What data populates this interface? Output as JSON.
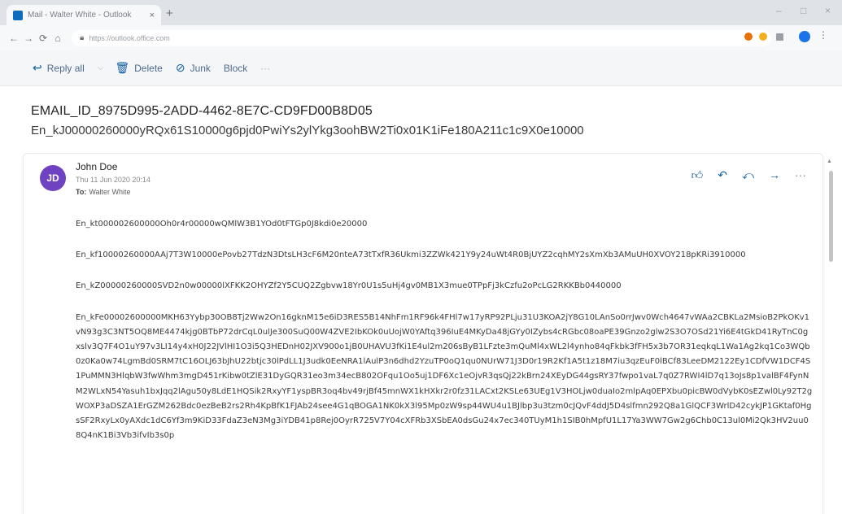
{
  "browser": {
    "tab_title": "Mail - Walter White - Outlook",
    "tab_close": "×",
    "new_tab": "+",
    "url": "https://outlook.office.com",
    "window_controls": [
      "–",
      "□",
      "×"
    ]
  },
  "toolbar": {
    "reply_all": "Reply all",
    "delete": "Delete",
    "junk": "Junk",
    "block": "Block",
    "more": "···"
  },
  "subject": {
    "line1": "EMAIL_ID_8975D995-2ADD-4462-8E7C-CD9FD00B8D05",
    "line2": "En_kJ00000260000yRQx61S10000g6pjd0PwiYs2ylYkg3oohBW2Ti0x01K1iFe180A211c1c9X0e10000"
  },
  "message": {
    "avatar_initials": "JD",
    "sender": "John Doe",
    "date": "Thu 11 Jun 2020 20:14",
    "to_label": "To:",
    "to": "Walter White",
    "more": "···",
    "body": [
      "En_kt000002600000Oh0r4r00000wQMlW3B1YOd0tFTGp0J8kdi0e20000",
      "En_kf10000260000AAj7T3W10000ePovb27TdzN3DtsLH3cF6M20nteA73tTxfR36Ukmi3ZZWk421Y9y24uWt4R0BjUYZ2cqhMY2sXmXb3AMuUH0XVOY218pKRi3910000",
      "En_kZ00000260000SVD2n0w00000lXFKK2OHYZf2Y5CUQ2Zgbvw18Yr0U1s5uHj4gv0MB1X3mue0TPpFj3kCzfu2oPcLG2RKKBb0440000",
      "En_kFe00002600000MKH63Yybp30OB8Tj2Ww2On16gknM15e6iD3RES5B14NhFm1RF96k4FHl7w17yRP92PLju31U3KOA2jY8G10LAnSo0rrJwv0Wch4647vWAa2CBKLa2MsioB2PkOKv1vN93g3C3NT5OQ8ME4474kjg0BTbP72drCqL0ulJe300SuQ00W4ZVE2IbKOk0uUojW0YAftq396IuE4MKyDa48jGYy0IZybs4cRGbc08oaPE39Gnzo2glw2S3O7OSd21Yi6E4tGkD41RyTnC0gxslv3Q7F4O1uY97v3LI14y4xH0J22JVlHI1O3i5Q3HEDnH02JXV900o1jB0UHAVU3fKi1E4ul2m206sByB1LFzte3mQuMl4xWL2l4ynho84qFkbk3fFH5x3b7OR31eqkqL1Wa1Ag2kq1Co3WQb0z0Ka0w74LgmBd0SRM7tC16OLJ63bJhU22btjc30lPdLL1J3udk0EeNRA1lAulP3n6dhd2YzuTP0oQ1qu0NUrW71J3D0r19R2Kf1A5t1z18M7iu3qzEuF0lBCf83LeeDM2122Ey1CDfVW1DCF4S1PuMMN3HlqbW3fwWhm3mgD451rKibw0tZlE31DyGQR31eo3m34ecB802OFqu1Oo5uj1DF6Xc1eOjvR3qsQj22kBrn24XEyDG44gsRY37fwpo1vaL7q0Z7RWI4lD7q13oJs8p1valBF4FynNM2WLxN54Yasuh1bxJqq2lAgu50y8LdE1HQSik2RxyYF1yspBR3oq4bv49rjBf45mnWX1kHXkr2r0fz31LACxt2KSLe63UEg1V3HOLjw0duaIo2mlpAq0EPXbu0picBW0dVybK0sEZwl0Ly92T2gWOXP3aDSZA1ErGZM262Bdc0ezBeB2rs2Rh4KpBfK1FJAb24see4G1qBOGA1NK0kX3l95Mp0zW9sp44WU4u1BJlbp3u3tzm0cJQvF4ddJ5D4slfmn292Q8a1GlQCF3WrlD42cykJP1GKtaf0HgsSF2RxyLx0yAXdc1dC6Yf3m9KiD33FdaZ3eN3Mg3iYDB41p8Rej0OyrR725V7Y04cXFRb3XSbEA0dsGu24x7ec340TUyM1h1SIB0hMpfU1L17Ya3WW7Gw2g6Chb0C13ul0Mi2Qk3HV2uu08Q4nK1Bi3Vb3ifvIb3s0p"
    ]
  },
  "colors": {
    "accent": "#115ea3",
    "avatar": "#6f42c1",
    "tabstrip": "#dfe3e8"
  },
  "icons": {
    "reply_all": "reply-all-icon",
    "delete": "trash-icon",
    "junk": "block-circle-icon",
    "like": "thumbs-up-icon",
    "reply": "reply-icon",
    "forward": "forward-icon"
  }
}
